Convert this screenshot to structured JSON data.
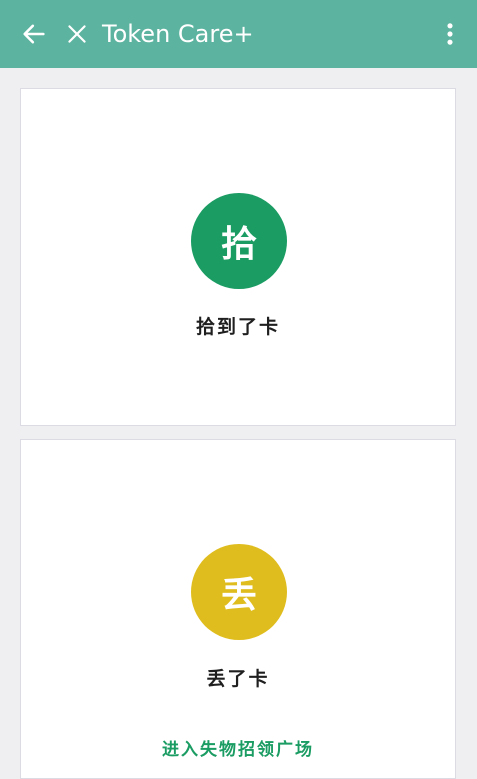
{
  "appbar": {
    "title": "Token Care+",
    "icons": {
      "back": "arrow-left-icon",
      "close": "close-icon",
      "more": "more-vert-icon"
    },
    "background": "#5cb39f"
  },
  "found_card": {
    "badge_text": "拾",
    "label": "拾到了卡",
    "color": "#1a9c63"
  },
  "lost_card": {
    "badge_text": "丢",
    "label": "丢了卡",
    "color": "#e0bd1e"
  },
  "plaza_link": {
    "text": "进入失物招领广场",
    "color": "#1a9c63"
  }
}
